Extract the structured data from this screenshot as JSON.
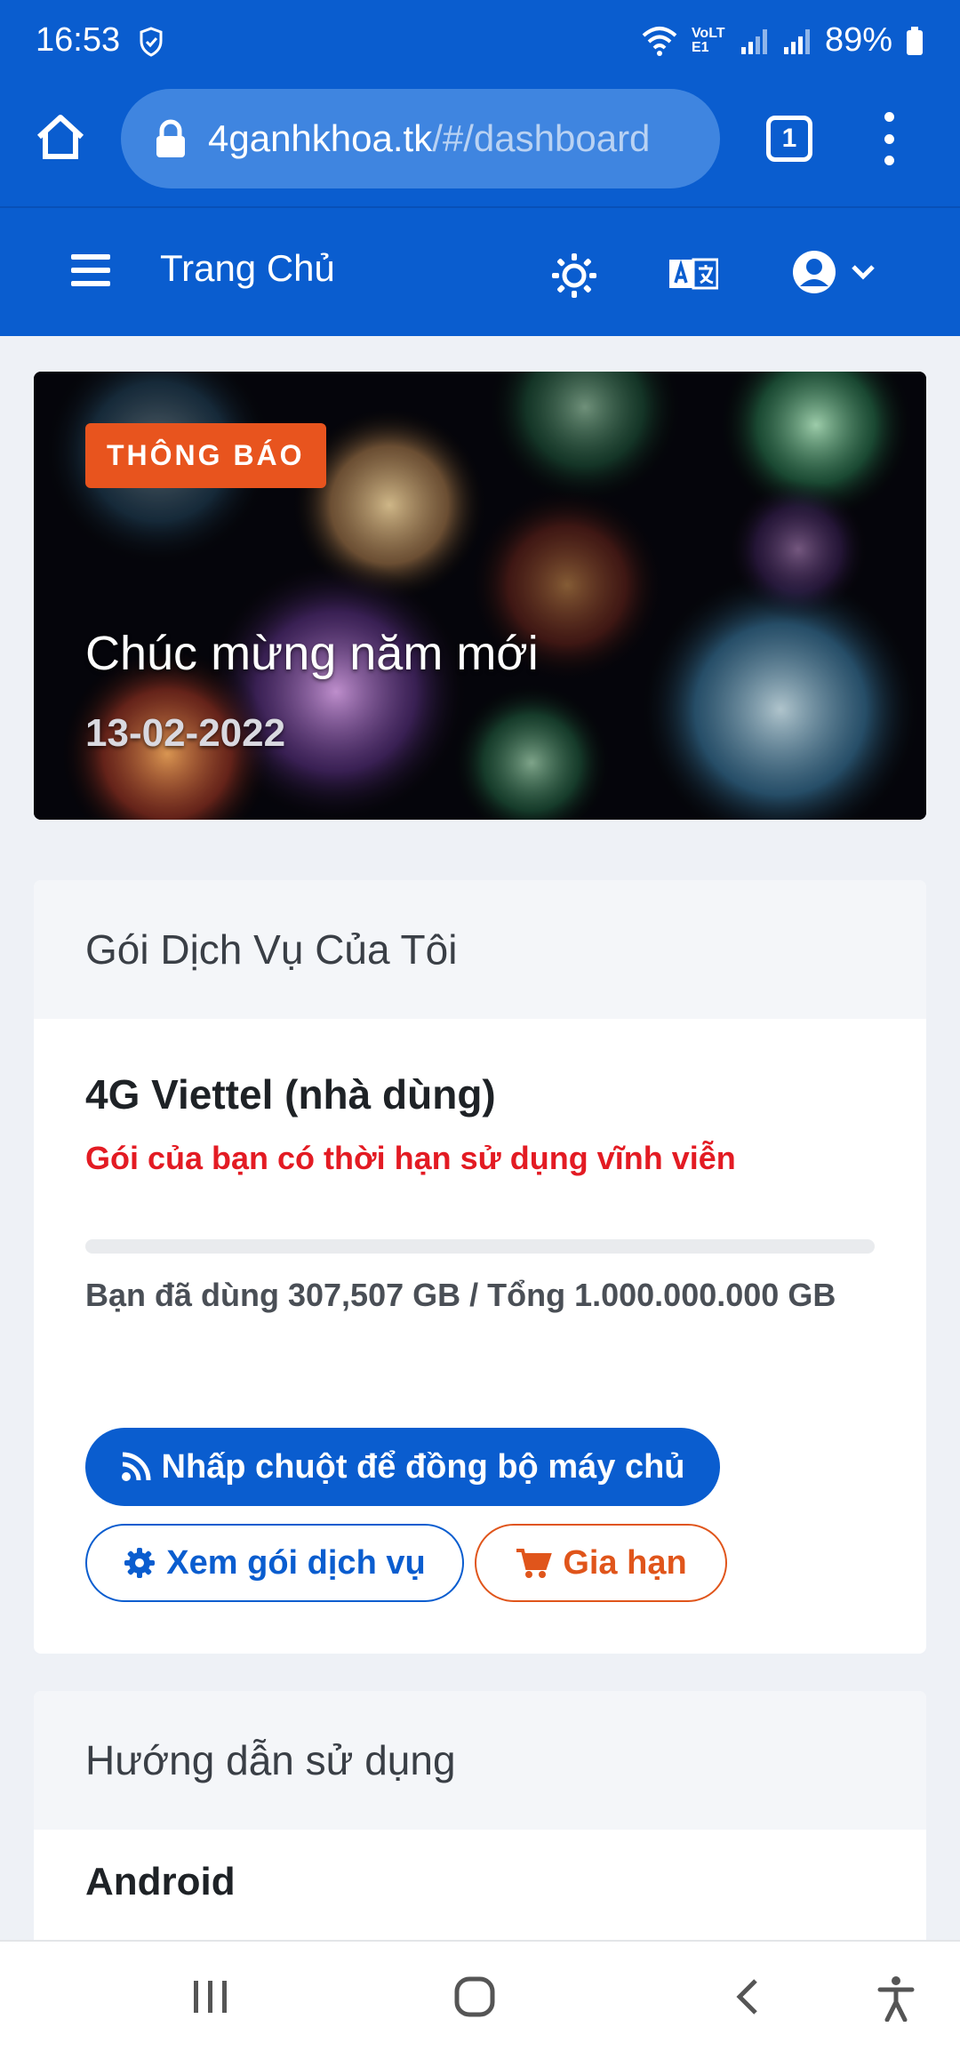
{
  "status_bar": {
    "time": "16:53",
    "battery": "89%",
    "network": "VoLTE1"
  },
  "browser": {
    "url_host": "4ganhkhoa.tk",
    "url_path": "/#/dashboard",
    "tab_count": "1"
  },
  "navbar": {
    "title": "Trang Chủ"
  },
  "announcement": {
    "badge": "THÔNG BÁO",
    "title": "Chúc mừng năm mới",
    "date": "13-02-2022"
  },
  "service_card": {
    "header": "Gói Dịch Vụ Của Tôi",
    "plan_name": "4G Viettel (nhà dùng)",
    "plan_note": "Gói của bạn có thời hạn sử dụng vĩnh viễn",
    "usage_fraction": 3e-07,
    "usage_text": "Bạn đã dùng 307,507 GB / Tổng 1.000.000.000 GB",
    "sync_button": "Nhấp chuột để đồng bộ máy chủ",
    "view_button": "Xem gói dịch vụ",
    "renew_button": "Gia hạn"
  },
  "guide_card": {
    "header": "Hướng dẫn sử dụng",
    "sub_heading": "Android"
  },
  "colors": {
    "primary": "#0a5dcf",
    "badge": "#e8541e",
    "alert": "#e31b23",
    "renew": "#e0551b"
  }
}
